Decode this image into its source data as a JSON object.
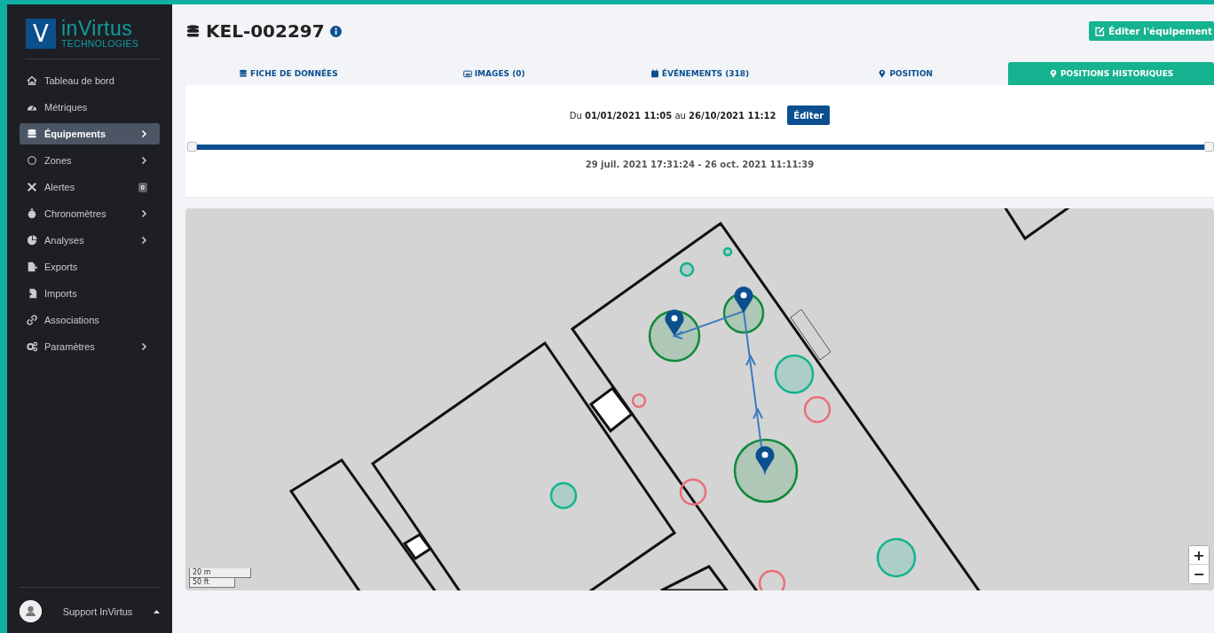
{
  "sidebar": {
    "logo": {
      "mark": "V",
      "name": "inVirtus",
      "tagline": "TECHNOLOGIES"
    },
    "items": [
      {
        "label": "Tableau de bord",
        "selected": false,
        "expandable": false
      },
      {
        "label": "Métriques",
        "selected": false,
        "expandable": false
      },
      {
        "label": "Équipements",
        "selected": true,
        "expandable": true
      },
      {
        "label": "Zones",
        "selected": false,
        "expandable": true
      },
      {
        "label": "Alertes",
        "selected": false,
        "expandable": false,
        "badge": "0"
      },
      {
        "label": "Chronomètres",
        "selected": false,
        "expandable": true
      },
      {
        "label": "Analyses",
        "selected": false,
        "expandable": true
      },
      {
        "label": "Exports",
        "selected": false,
        "expandable": false
      },
      {
        "label": "Imports",
        "selected": false,
        "expandable": false
      },
      {
        "label": "Associations",
        "selected": false,
        "expandable": false
      },
      {
        "label": "Paramètres",
        "selected": false,
        "expandable": true
      }
    ],
    "user": {
      "name": "Support InVirtus"
    }
  },
  "header": {
    "title": "KEL-002297",
    "edit_button": "Éditer l'équipement"
  },
  "tabs": [
    {
      "label": "FICHE DE DONNÉES",
      "selected": false
    },
    {
      "label": "IMAGES (0)",
      "selected": false
    },
    {
      "label": "ÉVÉNEMENTS (318)",
      "selected": false
    },
    {
      "label": "POSITION",
      "selected": false
    },
    {
      "label": "POSITIONS HISTORIQUES",
      "selected": true
    }
  ],
  "range": {
    "text": "Du **01/01/2021 11:05** au **26/10/2021 11:12**",
    "edit_button": "Éditer",
    "level": 1,
    "selection": "29 juil. 2021 17:31:24 - 26 oct. 2021 11:11:39"
  },
  "map": {
    "scale": [
      "20 m",
      "50 ft"
    ],
    "zoom_in": "+",
    "zoom_out": "−"
  }
}
